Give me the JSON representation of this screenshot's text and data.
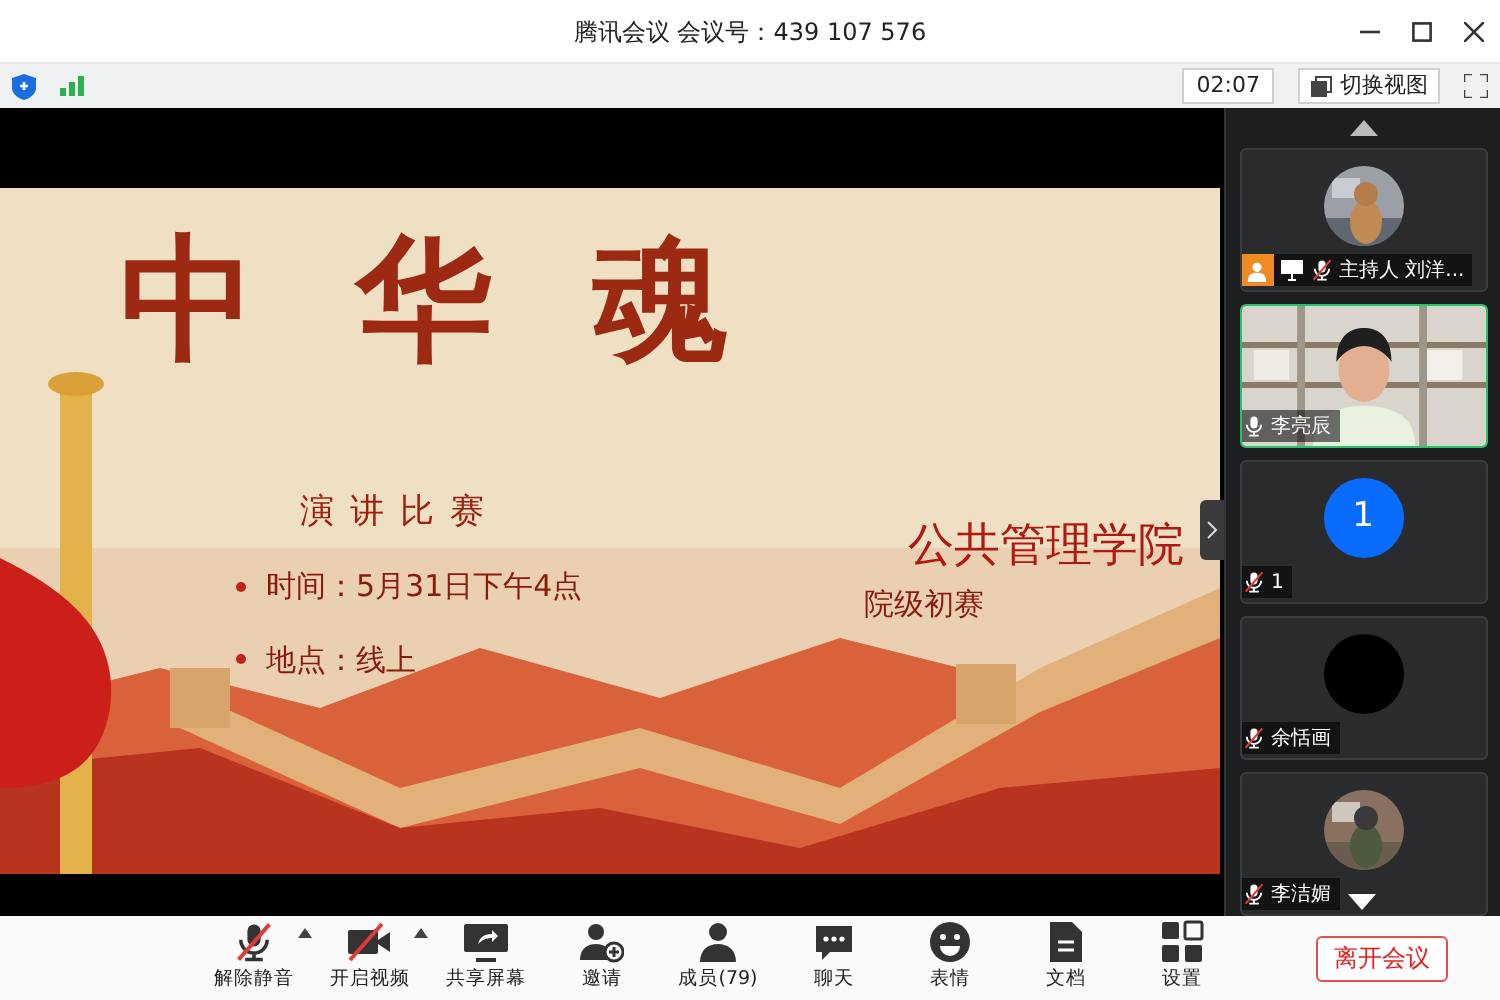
{
  "window": {
    "title": "腾讯会议 会议号：439 107 576"
  },
  "top_bar": {
    "timer": "02:07",
    "switch_view": "切换视图"
  },
  "slide": {
    "title": "中华魂",
    "subtitle": "演讲比赛",
    "bullets": [
      "时间：5月31日下午4点",
      "地点：线上"
    ],
    "organizer": "公共管理学院",
    "round": "院级初赛"
  },
  "participants": [
    {
      "name": "主持人 刘洋...",
      "muted": true,
      "host": true,
      "sharing": true,
      "speaking": false
    },
    {
      "name": "李亮辰",
      "kind": "video",
      "muted": false,
      "host": false,
      "sharing": false,
      "speaking": true
    },
    {
      "name": "1",
      "kind": "letter",
      "letter": "1",
      "muted": true,
      "host": false,
      "sharing": false,
      "speaking": false
    },
    {
      "name": "余恬画",
      "kind": "blank",
      "muted": true,
      "host": false,
      "sharing": false,
      "speaking": false
    },
    {
      "name": "李洁媚",
      "muted": true,
      "host": false,
      "sharing": false,
      "speaking": false
    }
  ],
  "toolbar": [
    {
      "kind": "mic",
      "label": "解除静音",
      "has_menu": true
    },
    {
      "kind": "video",
      "label": "开启视频",
      "has_menu": true
    },
    {
      "kind": "share",
      "label": "共享屏幕",
      "has_menu": false
    },
    {
      "kind": "invite",
      "label": "邀请",
      "has_menu": false
    },
    {
      "kind": "members",
      "label": "成员(79)",
      "has_menu": false
    },
    {
      "kind": "chat",
      "label": "聊天",
      "has_menu": false
    },
    {
      "kind": "emoji",
      "label": "表情",
      "has_menu": false
    },
    {
      "kind": "docs",
      "label": "文档",
      "has_menu": false
    },
    {
      "kind": "settings",
      "label": "设置",
      "has_menu": false
    }
  ],
  "leave_button": "离开会议"
}
